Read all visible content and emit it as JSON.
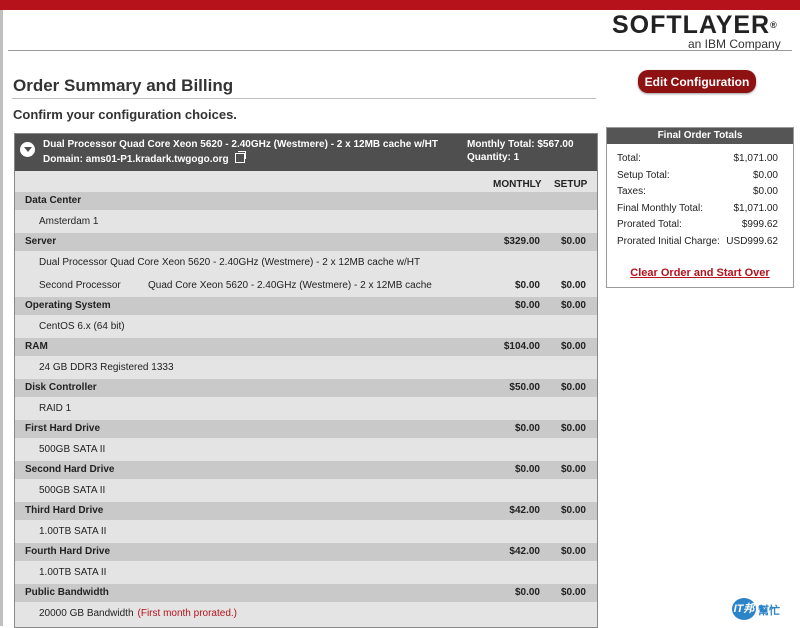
{
  "brand": {
    "logo_main": "SOFTLAYER",
    "logo_reg": "®",
    "logo_sub": "an IBM Company",
    "accent": "#b5121b"
  },
  "page": {
    "title": "Order Summary and Billing",
    "subtitle": "Confirm your configuration choices."
  },
  "edit_button": {
    "label": "Edit Configuration"
  },
  "order": {
    "title": "Dual Processor Quad Core Xeon 5620 - 2.40GHz (Westmere) - 2 x 12MB cache w/HT",
    "domain": "Domain: ams01-P1.kradark.twgogo.org",
    "monthly_total": "Monthly Total: $567.00",
    "quantity": "Quantity: 1",
    "col_monthly": "MONTHLY",
    "col_setup": "SETUP",
    "sections": [
      {
        "category": "Data Center",
        "monthly": "",
        "setup": "",
        "item": "Amsterdam 1"
      },
      {
        "category": "Server",
        "monthly": "$329.00",
        "setup": "$0.00",
        "item": "Dual Processor Quad Core Xeon 5620 - 2.40GHz (Westmere) - 2 x 12MB cache w/HT",
        "extra_label": "Second Processor",
        "extra_desc": "Quad Core Xeon 5620 - 2.40GHz (Westmere) - 2 x 12MB cache",
        "extra_monthly": "$0.00",
        "extra_setup": "$0.00"
      },
      {
        "category": "Operating System",
        "monthly": "$0.00",
        "setup": "$0.00",
        "item": "CentOS 6.x (64 bit)"
      },
      {
        "category": "RAM",
        "monthly": "$104.00",
        "setup": "$0.00",
        "item": "24 GB DDR3 Registered 1333"
      },
      {
        "category": "Disk Controller",
        "monthly": "$50.00",
        "setup": "$0.00",
        "item": "RAID 1"
      },
      {
        "category": "First Hard Drive",
        "monthly": "$0.00",
        "setup": "$0.00",
        "item": "500GB SATA II"
      },
      {
        "category": "Second Hard Drive",
        "monthly": "$0.00",
        "setup": "$0.00",
        "item": "500GB SATA II"
      },
      {
        "category": "Third Hard Drive",
        "monthly": "$42.00",
        "setup": "$0.00",
        "item": "1.00TB SATA II"
      },
      {
        "category": "Fourth Hard Drive",
        "monthly": "$42.00",
        "setup": "$0.00",
        "item": "1.00TB SATA II"
      },
      {
        "category": "Public Bandwidth",
        "monthly": "$0.00",
        "setup": "$0.00",
        "item": "20000 GB Bandwidth",
        "item_note": "(First month prorated.)"
      }
    ]
  },
  "totals": {
    "title": "Final Order Totals",
    "rows": [
      {
        "label": "Total:",
        "value": "$1,071.00"
      },
      {
        "label": "Setup Total:",
        "value": "$0.00"
      },
      {
        "label": "Taxes:",
        "value": "$0.00"
      },
      {
        "label": "Final Monthly Total:",
        "value": "$1,071.00"
      },
      {
        "label": "Prorated Total:",
        "value": "$999.62"
      },
      {
        "label": "Prorated Initial Charge:",
        "value": "USD999.62"
      }
    ],
    "clear_link": "Clear Order and Start Over"
  },
  "watermark": {
    "badge": "IT邦",
    "text": "幫忙"
  }
}
